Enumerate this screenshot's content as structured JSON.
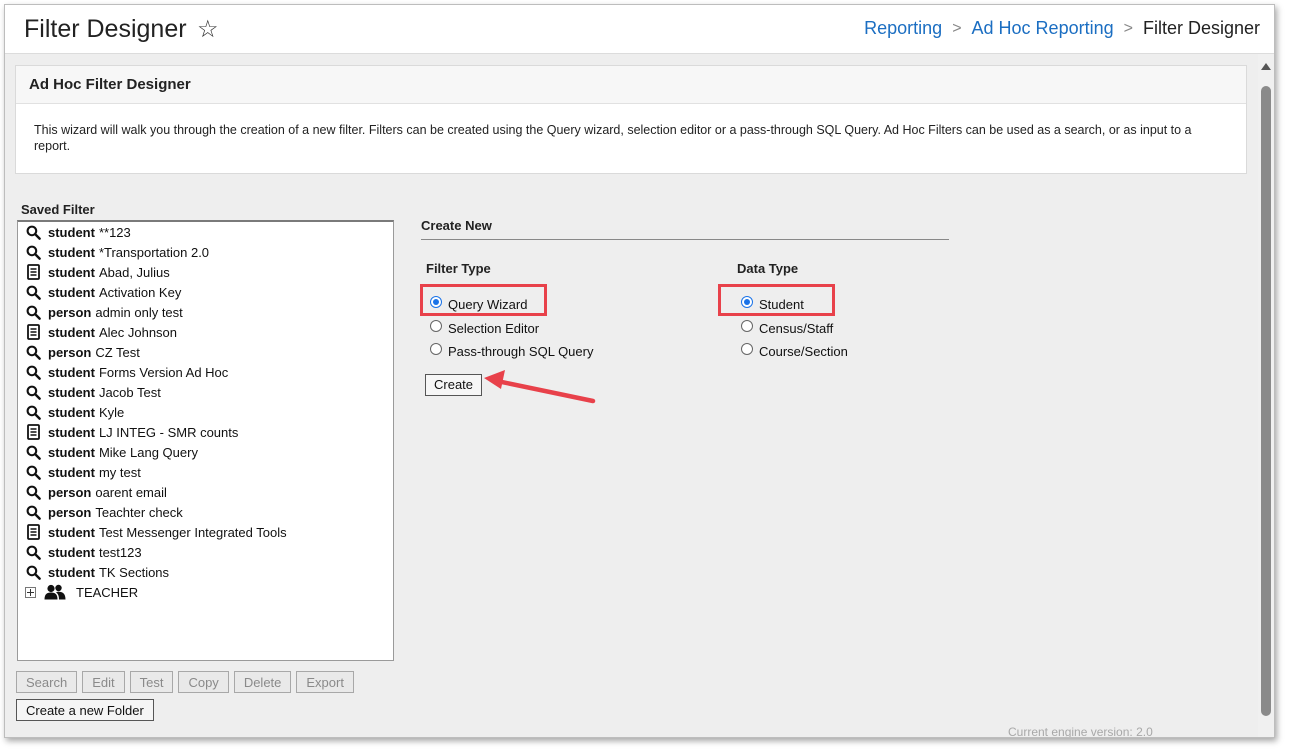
{
  "header": {
    "title": "Filter Designer",
    "breadcrumbs": [
      "Reporting",
      "Ad Hoc Reporting",
      "Filter Designer"
    ]
  },
  "panel": {
    "title": "Ad Hoc Filter Designer",
    "description": "This wizard will walk you through the creation of a new filter. Filters can be created using the Query wizard, selection editor or a pass-through SQL Query. Ad Hoc Filters can be used as a search, or as input to a report."
  },
  "saved_filter": {
    "label": "Saved Filter",
    "items": [
      {
        "icon": "search-icon",
        "type": "student",
        "name": "**123"
      },
      {
        "icon": "search-icon",
        "type": "student",
        "name": "*Transportation 2.0"
      },
      {
        "icon": "document-icon",
        "type": "student",
        "name": "Abad, Julius"
      },
      {
        "icon": "search-icon",
        "type": "student",
        "name": "Activation Key"
      },
      {
        "icon": "search-icon",
        "type": "person",
        "name": "admin only test"
      },
      {
        "icon": "document-icon",
        "type": "student",
        "name": "Alec Johnson"
      },
      {
        "icon": "search-icon",
        "type": "person",
        "name": "CZ Test"
      },
      {
        "icon": "search-icon",
        "type": "student",
        "name": "Forms Version Ad Hoc"
      },
      {
        "icon": "search-icon",
        "type": "student",
        "name": "Jacob Test"
      },
      {
        "icon": "search-icon",
        "type": "student",
        "name": "Kyle"
      },
      {
        "icon": "document-icon",
        "type": "student",
        "name": "LJ INTEG - SMR counts"
      },
      {
        "icon": "search-icon",
        "type": "student",
        "name": "Mike Lang Query"
      },
      {
        "icon": "search-icon",
        "type": "student",
        "name": "my test"
      },
      {
        "icon": "search-icon",
        "type": "person",
        "name": "oarent email"
      },
      {
        "icon": "search-icon",
        "type": "person",
        "name": "Teachter check"
      },
      {
        "icon": "document-icon",
        "type": "student",
        "name": "Test Messenger Integrated Tools"
      },
      {
        "icon": "search-icon",
        "type": "student",
        "name": "test123"
      },
      {
        "icon": "search-icon",
        "type": "student",
        "name": "TK Sections"
      }
    ],
    "folder": {
      "name": "TEACHER"
    }
  },
  "buttons": {
    "search": "Search",
    "edit": "Edit",
    "test": "Test",
    "copy": "Copy",
    "delete": "Delete",
    "export": "Export",
    "new_folder": "Create a new Folder"
  },
  "create_new": {
    "title": "Create New",
    "filter_type_label": "Filter Type",
    "filter_types": [
      "Query Wizard",
      "Selection Editor",
      "Pass-through SQL Query"
    ],
    "filter_type_selected": "Query Wizard",
    "data_type_label": "Data Type",
    "data_types": [
      "Student",
      "Census/Staff",
      "Course/Section"
    ],
    "data_type_selected": "Student",
    "create_label": "Create"
  },
  "footer": {
    "engine": "Current engine version: 2.0"
  },
  "colors": {
    "link": "#1b6ec2",
    "highlight": "#e8414a",
    "radio": "#1a73e8"
  }
}
